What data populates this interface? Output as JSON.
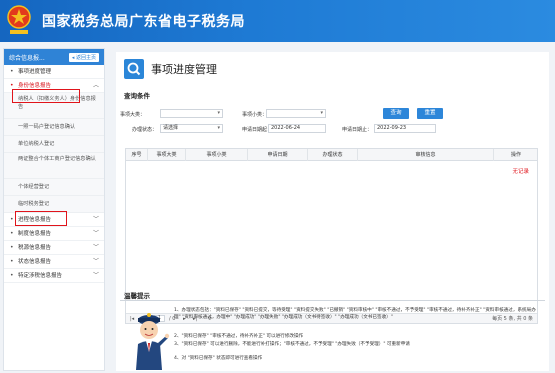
{
  "header": {
    "title": "国家税务总局广东省电子税务局",
    "colors": {
      "brand": "#1e7ad4",
      "accent": "#d8121a"
    }
  },
  "sidebar": {
    "top_label": "综合信息报...",
    "back_label": "◂ 返回主页",
    "items": [
      {
        "label": "事项进度管理"
      },
      {
        "label": "身份信息报告"
      },
      {
        "label": "纳税人（扣缴义务人）身份信息报告"
      },
      {
        "label": "一照一码户登记信息确认"
      },
      {
        "label": "单位纳税人登记"
      },
      {
        "label": "两证整合个体工商户登记信息确认"
      },
      {
        "label": "个体经营登记"
      },
      {
        "label": "临时税务登记"
      },
      {
        "label": "进程信息报告"
      },
      {
        "label": "制度信息报告"
      },
      {
        "label": "税源信息报告"
      },
      {
        "label": "状态信息报告"
      },
      {
        "label": "特定涉税信息报告"
      }
    ]
  },
  "main": {
    "title": "事项进度管理",
    "query_section": "查询条件",
    "filters": {
      "category_label": "事项大类：",
      "category_value": "",
      "subcategory_label": "事项小类：",
      "subcategory_value": "",
      "status_label": "办理状态：",
      "status_value": "请选择",
      "start_label": "申请日期起：",
      "start_value": "2022-06-24",
      "end_label": "申请日期止：",
      "end_value": "2022-09-23"
    },
    "buttons": {
      "query": "查询",
      "reset": "重置"
    },
    "table": {
      "headers": [
        "序号",
        "事项大类",
        "事项小类",
        "申请日期",
        "办理状态",
        "审核信息",
        "操作"
      ],
      "empty_text": "无记录"
    },
    "pager": {
      "current_page": "1",
      "total_pages": "/ 0",
      "summary": "每页 5 条, 共 0 条"
    },
    "tips": {
      "title": "温馨提示",
      "lines": [
        "1、办理状态包括：\"资料已保存\" \"资料已提交，等待受理\" \"资料提交失败\" \"已撤销\" \"资料审核中\" \"审核不通过，不予受理\" \"审核不通过，待补齐补正\" \"资料审核通过，系统局办理\" \"资料审核通过，办理中\" \"办理成功\" \"办理失败\" \"办理成功（文书待签收）\" \"办理成功（文书已签收）\"",
        "2、\"资料已保存\" \"审核不通过，待补齐补正\" 可以进行修改操作",
        "3、\"资料已保存\" 可以进行删除，不能进行补打操作；\"审核不通过，不予受理\" \"办理失败（不予受理）\" 可重新申请",
        "4、对 \"资料已保存\" 状态即可进行查看操作"
      ]
    }
  }
}
